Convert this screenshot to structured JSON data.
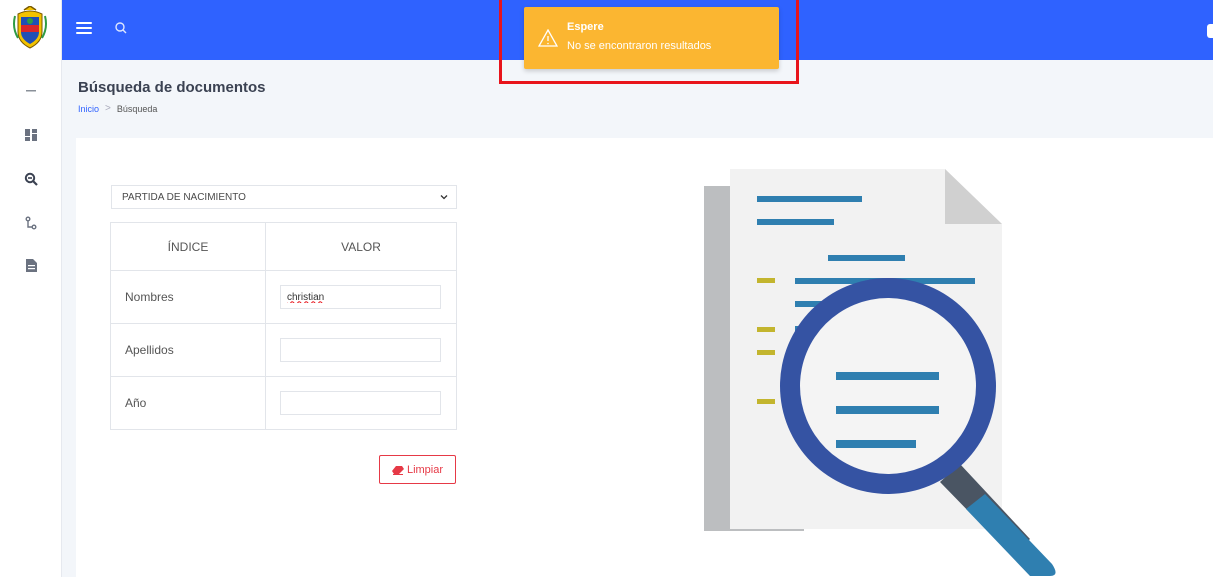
{
  "app": {
    "page_title": "Búsqueda de documentos"
  },
  "breadcrumb": {
    "home": "Inicio",
    "current": "Búsqueda"
  },
  "toast": {
    "title": "Espere",
    "message": "No se encontraron resultados",
    "icon": "warning-icon",
    "color": "#fbb631"
  },
  "topbar": {
    "color": "#2f62ff",
    "icons": [
      "menu-icon",
      "search-icon"
    ]
  },
  "sidebar": {
    "items": [
      {
        "icon": "collapse-icon"
      },
      {
        "icon": "dashboard-icon"
      },
      {
        "icon": "search-document-icon"
      },
      {
        "icon": "flow-icon"
      },
      {
        "icon": "file-icon"
      }
    ]
  },
  "form": {
    "document_type": "PARTIDA DE NACIMIENTO",
    "columns": [
      "ÍNDICE",
      "VALOR"
    ],
    "rows": [
      {
        "label": "Nombres",
        "value": "christian"
      },
      {
        "label": "Apellidos",
        "value": ""
      },
      {
        "label": "Año",
        "value": ""
      }
    ],
    "clear_label": "Limpiar"
  }
}
